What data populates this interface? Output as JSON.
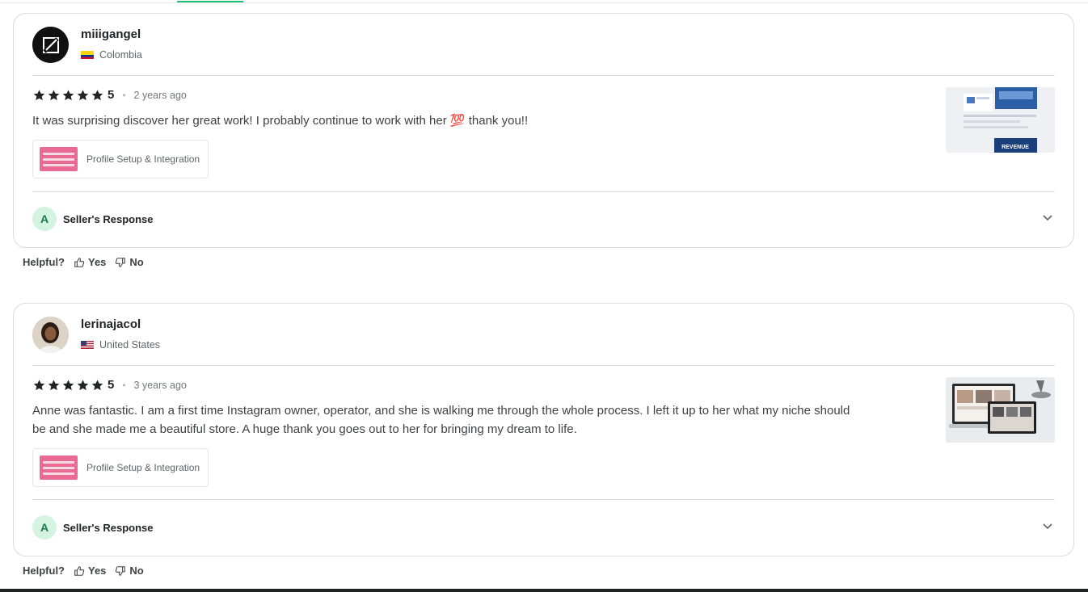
{
  "reviews": [
    {
      "username": "miiigangel",
      "country": "Colombia",
      "rating": "5",
      "time": "2 years ago",
      "text": "It was surprising discover her great work! I probably continue to work with her 💯 thank you!!",
      "gig_label": "Profile Setup & Integration",
      "seller_response_label": "Seller's Response",
      "seller_initial": "A"
    },
    {
      "username": "lerinajacol",
      "country": "United States",
      "rating": "5",
      "time": "3 years ago",
      "text": "Anne was fantastic. I am a first time Instagram owner, operator, and she is walking me through the whole process. I left it up to her what my niche should be and she made me a beautiful store. A huge thank you goes out to her for bringing my dream to life.",
      "gig_label": "Profile Setup & Integration",
      "seller_response_label": "Seller's Response",
      "seller_initial": "A"
    }
  ],
  "helpful": {
    "label": "Helpful?",
    "yes": "Yes",
    "no": "No"
  },
  "thumb1_banner": "REVENUE",
  "colors": {
    "accent": "#1dbf73",
    "star": "#222325"
  }
}
